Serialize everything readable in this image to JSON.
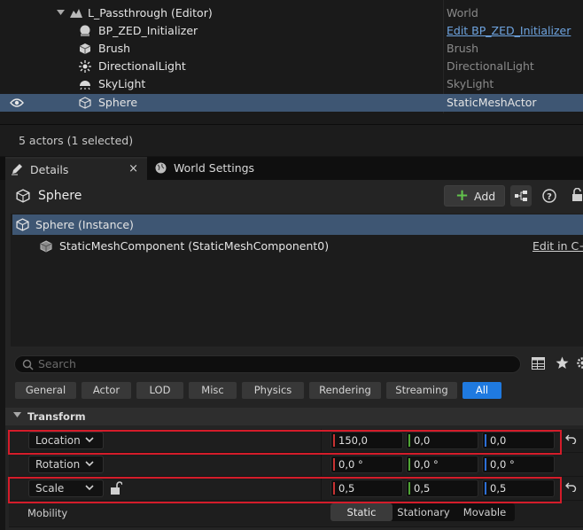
{
  "outliner": {
    "root": {
      "label": "L_Passthrough (Editor)",
      "type": "World"
    },
    "items": [
      {
        "label": "BP_ZED_Initializer",
        "type": "Edit BP_ZED_Initializer",
        "icon": "blueprint-sphere-icon"
      },
      {
        "label": "Brush",
        "type": "Brush",
        "icon": "brush-cube-icon"
      },
      {
        "label": "DirectionalLight",
        "type": "DirectionalLight",
        "icon": "sun-icon"
      },
      {
        "label": "SkyLight",
        "type": "SkyLight",
        "icon": "skylight-icon"
      },
      {
        "label": "Sphere",
        "type": "StaticMeshActor",
        "icon": "static-mesh-icon",
        "selected": true
      }
    ],
    "status": "5 actors (1 selected)"
  },
  "tabs": {
    "details": "Details",
    "close": "×",
    "world_settings": "World Settings"
  },
  "details": {
    "title": "Sphere",
    "add_label": "Add",
    "components": {
      "instance": "Sphere (Instance)",
      "component": "StaticMeshComponent (StaticMeshComponent0)",
      "edit_cpp": "Edit in C++"
    },
    "search_placeholder": "Search",
    "filters": [
      "General",
      "Actor",
      "LOD",
      "Misc",
      "Physics",
      "Rendering",
      "Streaming",
      "All"
    ],
    "active_filter": "All",
    "section": "Transform",
    "location": {
      "label": "Location",
      "x": "150,0",
      "y": "0,0",
      "z": "0,0"
    },
    "rotation": {
      "label": "Rotation",
      "x": "0,0 °",
      "y": "0,0 °",
      "z": "0,0 °"
    },
    "scale": {
      "label": "Scale",
      "x": "0,5",
      "y": "0,5",
      "z": "0,5"
    },
    "mobility": {
      "label": "Mobility",
      "options": [
        "Static",
        "Stationary",
        "Movable"
      ],
      "selected": "Static"
    }
  },
  "colors": {
    "selection": "#3e5673",
    "accent": "#1f7ae0",
    "x_axis": "#c83232",
    "y_axis": "#4fa534",
    "z_axis": "#2c6fd6",
    "highlight_box": "#d41c2a",
    "add_plus": "#62c34c"
  }
}
